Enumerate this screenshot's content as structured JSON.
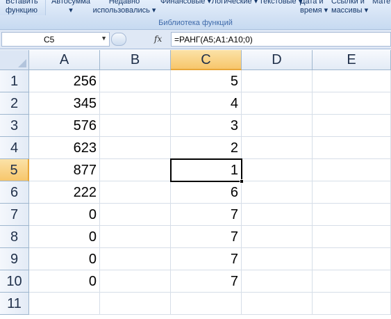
{
  "ribbon": {
    "insert_function": [
      "Вставить",
      "функцию"
    ],
    "autosum": [
      "Автосумма",
      "▾"
    ],
    "recent": [
      "Недавно",
      "использовались ▾"
    ],
    "financial": [
      "Финансовые ▾",
      ""
    ],
    "logical": [
      "Логические ▾",
      ""
    ],
    "text": [
      "Текстовые ▾",
      ""
    ],
    "datetime": [
      "Дата и",
      "время ▾"
    ],
    "lookup": [
      "Ссылки и",
      "массивы ▾"
    ],
    "math": [
      "Мате",
      ""
    ],
    "group_label": "Библиотека функций"
  },
  "formula_bar": {
    "name_box": "C5",
    "fx": "fx",
    "formula": "=РАНГ(A5;A1:A10;0)"
  },
  "sheet": {
    "columns": [
      "A",
      "B",
      "C",
      "D",
      "E"
    ],
    "active_column": "C",
    "active_row": 5,
    "rows": [
      {
        "n": "1",
        "A": "256",
        "B": "",
        "C": "5"
      },
      {
        "n": "2",
        "A": "345",
        "B": "",
        "C": "4"
      },
      {
        "n": "3",
        "A": "576",
        "B": "",
        "C": "3"
      },
      {
        "n": "4",
        "A": "623",
        "B": "",
        "C": "2"
      },
      {
        "n": "5",
        "A": "877",
        "B": "",
        "C": "1"
      },
      {
        "n": "6",
        "A": "222",
        "B": "",
        "C": "6"
      },
      {
        "n": "7",
        "A": "0",
        "B": "",
        "C": "7"
      },
      {
        "n": "8",
        "A": "0",
        "B": "",
        "C": "7"
      },
      {
        "n": "9",
        "A": "0",
        "B": "",
        "C": "7"
      },
      {
        "n": "10",
        "A": "0",
        "B": "",
        "C": "7"
      },
      {
        "n": "11",
        "A": "",
        "B": "",
        "C": ""
      }
    ]
  },
  "colors": {
    "active_header": "#f7c66b",
    "header": "#e3ebf6",
    "ribbon": "#d2e1f4"
  }
}
